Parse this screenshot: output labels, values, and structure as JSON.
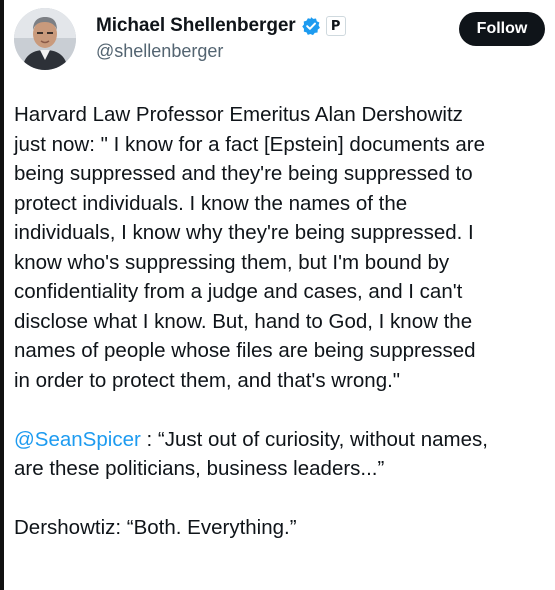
{
  "author": {
    "display_name": "Michael Shellenberger",
    "handle": "@shellenberger",
    "affiliate_badge": "P",
    "verified_icon": "verified-badge-icon",
    "avatar_icon": "avatar-photo"
  },
  "actions": {
    "follow_label": "Follow"
  },
  "tweet": {
    "paragraph_1": "Harvard Law Professor Emeritus Alan Dershowitz\njust now: \" I know for a fact [Epstein] documents are\nbeing suppressed and they're being suppressed to\nprotect individuals. I know the names of the\nindividuals, I know why they're being suppressed. I\nknow who's suppressing them, but I'm bound by\nconfidentiality from a judge and cases, and I can't\ndisclose what I know. But, hand to God, I know the\nnames of people whose files are being suppressed\nin order to protect them, and that's wrong.\"",
    "mention": "@SeanSpicer",
    "paragraph_2_rest": " : “Just out of curiosity, without names,\nare these politicians, business leaders...”",
    "paragraph_3": "Dershowtiz: “Both. Everything.”"
  },
  "colors": {
    "mention": "#1d9bf0",
    "verified": "#1d9bf0",
    "follow_bg": "#0f1419",
    "handle": "#536471"
  }
}
